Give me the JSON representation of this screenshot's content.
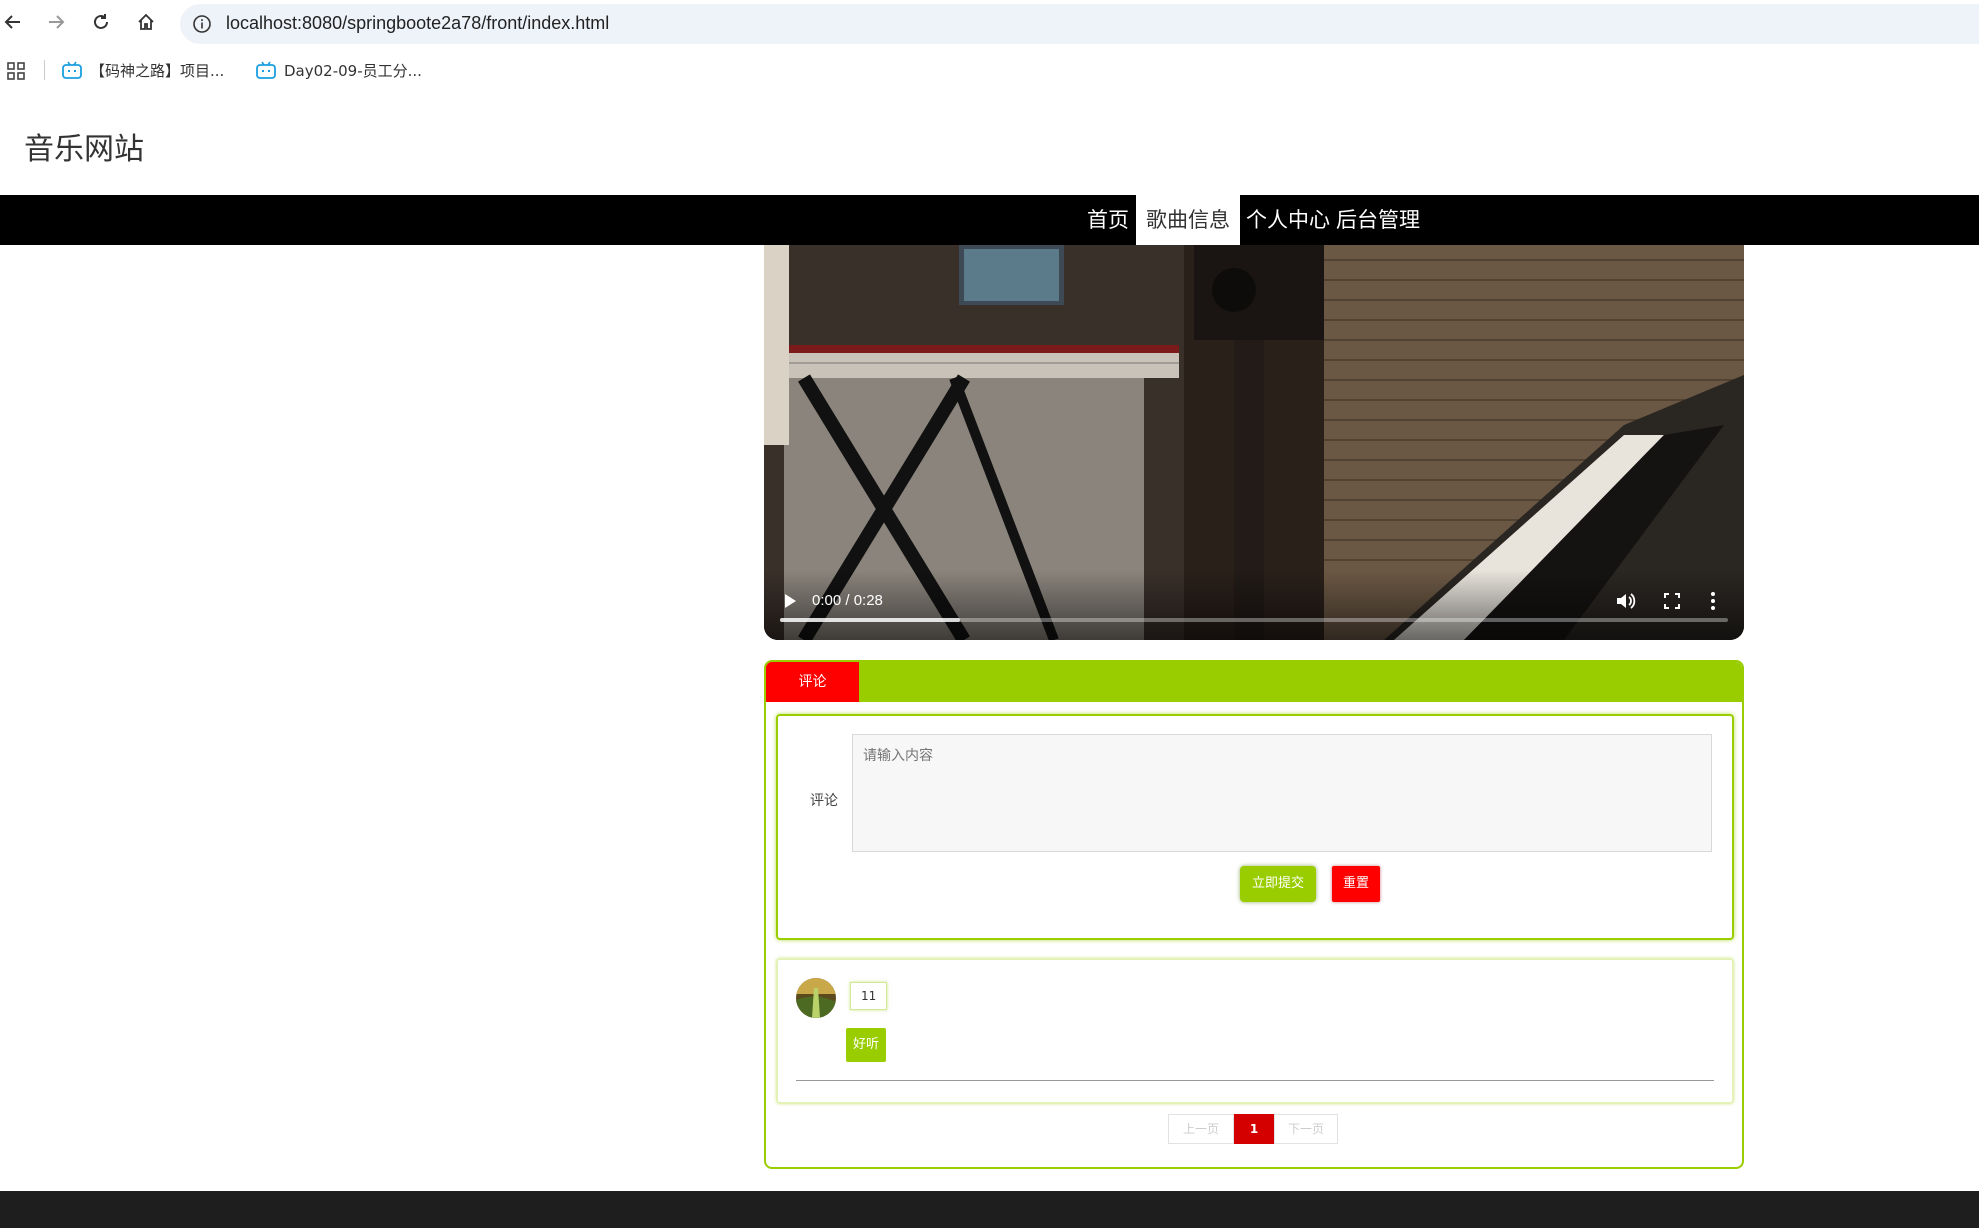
{
  "browser": {
    "url": "localhost:8080/springboote2a78/front/index.html",
    "bookmarks": [
      "【码神之路】项目...",
      "Day02-09-员工分..."
    ]
  },
  "site": {
    "title": "音乐网站",
    "nav": [
      "首页",
      "歌曲信息",
      "个人中心",
      "后台管理"
    ],
    "active_nav": "歌曲信息"
  },
  "video": {
    "time": "0:00 / 0:28",
    "buffered": 0.19
  },
  "comments": {
    "tab_label": "评论",
    "form_label": "评论",
    "placeholder": "请输入内容",
    "submit_label": "立即提交",
    "reset_label": "重置",
    "items": [
      {
        "user": "11",
        "text": "好听"
      }
    ],
    "pager": {
      "prev": "上一页",
      "current": "1",
      "next": "下一页"
    }
  },
  "colors": {
    "accent": "#9acd00",
    "danger": "#ff0000",
    "nav_bg": "#000000"
  }
}
